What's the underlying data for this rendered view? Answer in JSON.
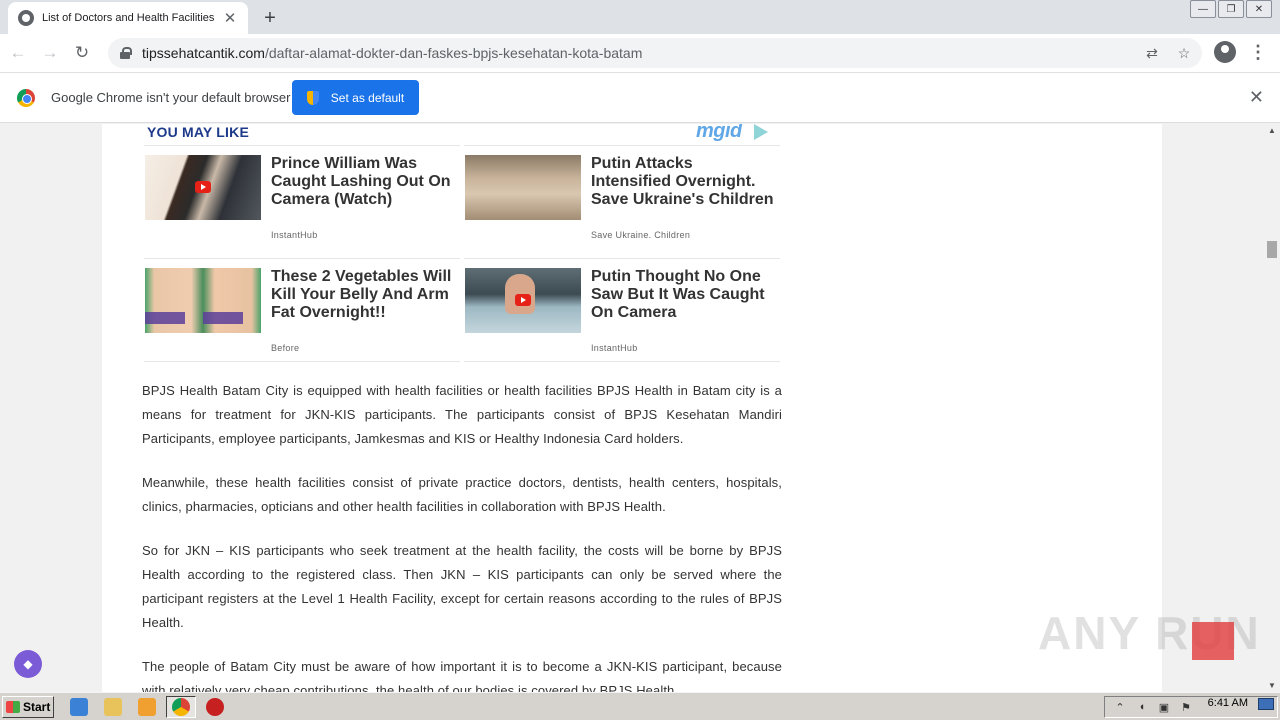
{
  "browser": {
    "tab_title": "List of Doctors and Health Facilities B",
    "new_tab_symbol": "+",
    "url_host": "tipssehatcantik.com",
    "url_path": "/daftar-alamat-dokter-dan-faskes-bpjs-kesehatan-kota-batam"
  },
  "infobar": {
    "message": "Google Chrome isn't your default browser",
    "button_label": "Set as default"
  },
  "ads": {
    "header": "YOU MAY LIKE",
    "brand": "mgid",
    "cards": [
      {
        "title": "Prince William Was Caught Lashing Out On Camera (Watch)",
        "source": "InstantHub"
      },
      {
        "title": "Putin Attacks Intensified Overnight. Save Ukraine's Children",
        "source": "Save Ukraine. Children"
      },
      {
        "title": "These 2 Vegetables Will Kill Your Belly And Arm Fat Overnight!!",
        "source": "Before"
      },
      {
        "title": "Putin Thought No One Saw But It Was Caught On Camera",
        "source": "InstantHub"
      }
    ]
  },
  "article": {
    "paragraphs": [
      "BPJS Health Batam City is equipped with health facilities or health facilities BPJS Health in Batam city is a means for treatment for JKN-KIS participants. The participants consist of BPJS Kesehatan Mandiri Participants, employee participants, Jamkesmas and KIS or Healthy Indonesia Card holders.",
      "Meanwhile, these health facilities consist of private practice doctors, dentists, health centers, hospitals, clinics, pharmacies, opticians and other health facilities in collaboration with BPJS Health.",
      "So for JKN – KIS participants who seek treatment at the health facility, the costs will be borne by BPJS Health according to the registered class. Then JKN – KIS participants can only be served where the participant registers at the Level 1 Health Facility, except for certain reasons according to the rules of BPJS Health.",
      "The people of Batam City must be aware of how important it is to become a JKN-KIS participant, because with relatively very cheap contributions, the health of our bodies is covered by BPJS Health."
    ]
  },
  "watermark": "ANY RUN",
  "taskbar": {
    "start_label": "Start",
    "clock": "6:41 AM"
  }
}
